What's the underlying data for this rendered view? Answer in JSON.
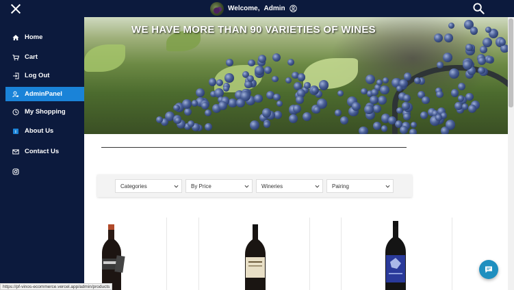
{
  "topbar": {
    "welcome_text": "Welcome,",
    "user_name": "Admin"
  },
  "sidebar": {
    "items": [
      {
        "label": "Home",
        "icon": "home-icon"
      },
      {
        "label": "Cart",
        "icon": "cart-icon"
      },
      {
        "label": "Log Out",
        "icon": "logout-icon"
      },
      {
        "label": "AdminPanel",
        "icon": "admin-icon",
        "active": true
      },
      {
        "label": "My Shopping",
        "icon": "history-icon"
      },
      {
        "label": "About Us",
        "icon": "about-icon"
      },
      {
        "label": "Contact Us",
        "icon": "mail-icon"
      },
      {
        "label": "",
        "icon": "instagram-icon"
      }
    ]
  },
  "hero": {
    "title": "WE HAVE MORE THAN 90 VARIETIES OF WINES"
  },
  "filters": {
    "categories": "Categories",
    "price": "By Price",
    "wineries": "Wineries",
    "pairing": "Pairing"
  },
  "status_url": "https://pf-vinos-ecommerce.vercel.app/admin/products",
  "colors": {
    "nav_bg": "#0c1a3d",
    "active_item": "#1a83d8",
    "chat_button": "#1f8fbf"
  }
}
